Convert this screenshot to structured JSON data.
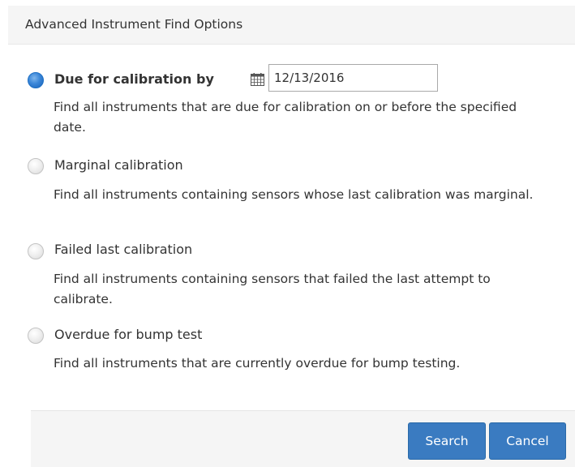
{
  "dialog": {
    "title": "Advanced Instrument Find Options"
  },
  "options": [
    {
      "label": "Due for calibration by",
      "description": "Find all instruments that are due for calibration on or before the specified date.",
      "checked": true
    },
    {
      "label": "Marginal calibration",
      "description": "Find all instruments containing sensors whose last calibration was marginal.",
      "checked": false
    },
    {
      "label": "Failed last calibration",
      "description": "Find all instruments containing sensors that failed the last attempt to calibrate.",
      "checked": false
    },
    {
      "label": "Overdue for bump test",
      "description": "Find all instruments that are currently overdue for bump testing.",
      "checked": false
    }
  ],
  "date_field": {
    "value": "12/13/2016",
    "icon": "calendar-icon"
  },
  "buttons": {
    "search_label": "Search",
    "cancel_label": "Cancel"
  },
  "colors": {
    "primary_button": "#3a7bc1",
    "selected_radio": "#2a77cf",
    "header_background": "#f5f5f5"
  }
}
